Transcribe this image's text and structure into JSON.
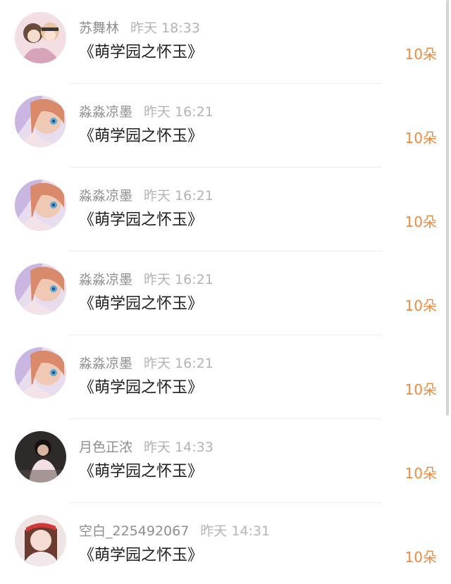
{
  "items": [
    {
      "name": "苏舞林",
      "time": "昨天 18:33",
      "title": "《萌学园之怀玉》",
      "amount": "10朵",
      "avatar": "anime-duo"
    },
    {
      "name": "淼淼凉墨",
      "time": "昨天 16:21",
      "title": "《萌学园之怀玉》",
      "amount": "10朵",
      "avatar": "anime-girl"
    },
    {
      "name": "淼淼凉墨",
      "time": "昨天 16:21",
      "title": "《萌学园之怀玉》",
      "amount": "10朵",
      "avatar": "anime-girl"
    },
    {
      "name": "淼淼凉墨",
      "time": "昨天 16:21",
      "title": "《萌学园之怀玉》",
      "amount": "10朵",
      "avatar": "anime-girl"
    },
    {
      "name": "淼淼凉墨",
      "time": "昨天 16:21",
      "title": "《萌学园之怀玉》",
      "amount": "10朵",
      "avatar": "anime-girl"
    },
    {
      "name": "月色正浓",
      "time": "昨天 14:33",
      "title": "《萌学园之怀玉》",
      "amount": "10朵",
      "avatar": "dark-photo"
    },
    {
      "name": "空白_225492067",
      "time": "昨天 14:31",
      "title": "《萌学园之怀玉》",
      "amount": "10朵",
      "avatar": "red-hair-photo"
    }
  ]
}
